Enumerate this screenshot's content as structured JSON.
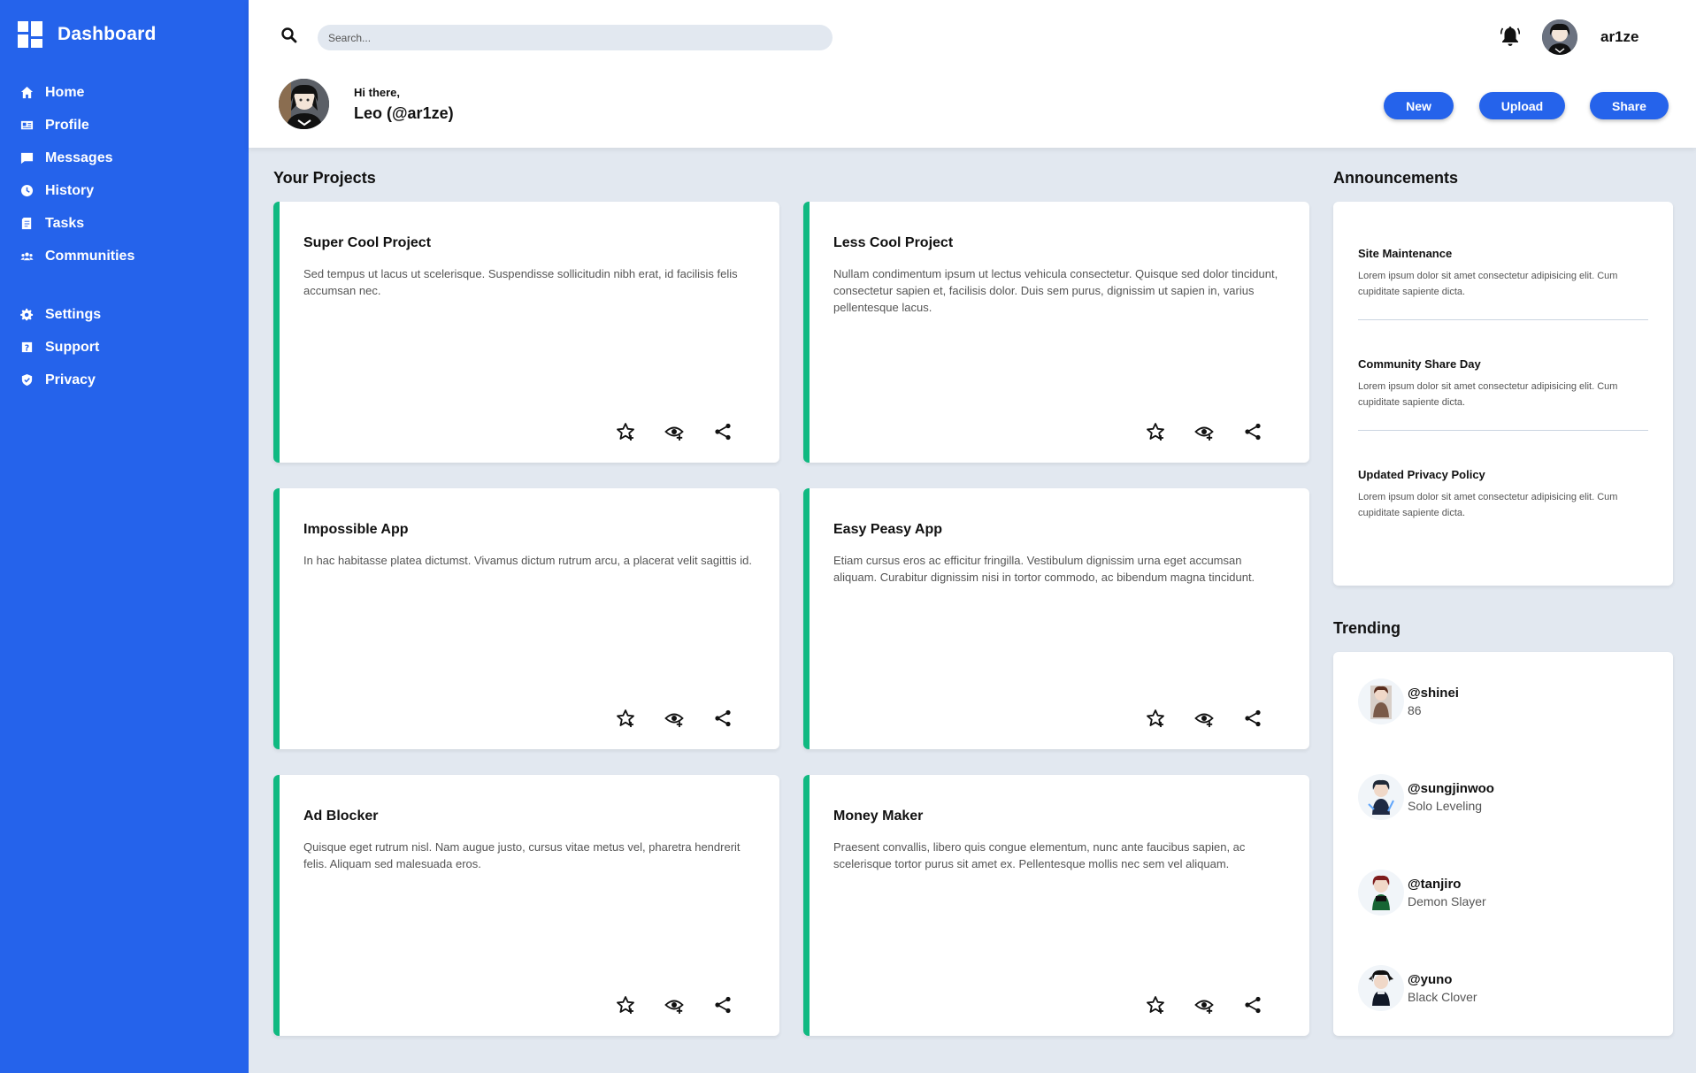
{
  "sidebar": {
    "title": "Dashboard",
    "items": [
      {
        "label": "Home",
        "icon": "home-icon"
      },
      {
        "label": "Profile",
        "icon": "profile-card-icon"
      },
      {
        "label": "Messages",
        "icon": "message-icon"
      },
      {
        "label": "History",
        "icon": "clock-icon"
      },
      {
        "label": "Tasks",
        "icon": "clipboard-icon"
      },
      {
        "label": "Communities",
        "icon": "group-icon"
      }
    ],
    "secondary_items": [
      {
        "label": "Settings",
        "icon": "gear-icon"
      },
      {
        "label": "Support",
        "icon": "help-icon"
      },
      {
        "label": "Privacy",
        "icon": "shield-icon"
      }
    ],
    "color": "#2563eb"
  },
  "header": {
    "search_placeholder": "Search...",
    "username": "ar1ze",
    "greeting": "Hi there,",
    "display_name": "Leo (@ar1ze)",
    "buttons": {
      "new": "New",
      "upload": "Upload",
      "share": "Share"
    }
  },
  "projects": {
    "title": "Your Projects",
    "accent": "#10b981",
    "items": [
      {
        "title": "Super Cool Project",
        "description": "Sed tempus ut lacus ut scelerisque. Suspendisse sollicitudin nibh erat, id facilisis felis accumsan nec."
      },
      {
        "title": "Less Cool Project",
        "description": "Nullam condimentum ipsum ut lectus vehicula consectetur. Quisque sed dolor tincidunt, consectetur sapien et, facilisis dolor. Duis sem purus, dignissim ut sapien in, varius pellentesque lacus."
      },
      {
        "title": "Impossible App",
        "description": "In hac habitasse platea dictumst. Vivamus dictum rutrum arcu, a placerat velit sagittis id."
      },
      {
        "title": "Easy Peasy App",
        "description": "Etiam cursus eros ac efficitur fringilla. Vestibulum dignissim urna eget accumsan aliquam. Curabitur dignissim nisi in tortor commodo, ac bibendum magna tincidunt."
      },
      {
        "title": "Ad Blocker",
        "description": "Quisque eget rutrum nisl. Nam augue justo, cursus vitae metus vel, pharetra hendrerit felis. Aliquam sed malesuada eros."
      },
      {
        "title": "Money Maker",
        "description": "Praesent convallis, libero quis congue elementum, nunc ante faucibus sapien, ac scelerisque tortor purus sit amet ex. Pellentesque mollis nec sem vel aliquam."
      }
    ]
  },
  "announcements": {
    "title": "Announcements",
    "items": [
      {
        "title": "Site Maintenance",
        "text": "Lorem ipsum dolor sit amet consectetur adipisicing elit. Cum cupiditate sapiente dicta."
      },
      {
        "title": "Community Share Day",
        "text": "Lorem ipsum dolor sit amet consectetur adipisicing elit. Cum cupiditate sapiente dicta."
      },
      {
        "title": "Updated Privacy Policy",
        "text": "Lorem ipsum dolor sit amet consectetur adipisicing elit. Cum cupiditate sapiente dicta."
      }
    ]
  },
  "trending": {
    "title": "Trending",
    "items": [
      {
        "handle": "@shinei",
        "subtitle": "86"
      },
      {
        "handle": "@sungjinwoo",
        "subtitle": "Solo Leveling"
      },
      {
        "handle": "@tanjiro",
        "subtitle": "Demon Slayer"
      },
      {
        "handle": "@yuno",
        "subtitle": "Black Clover"
      }
    ]
  }
}
